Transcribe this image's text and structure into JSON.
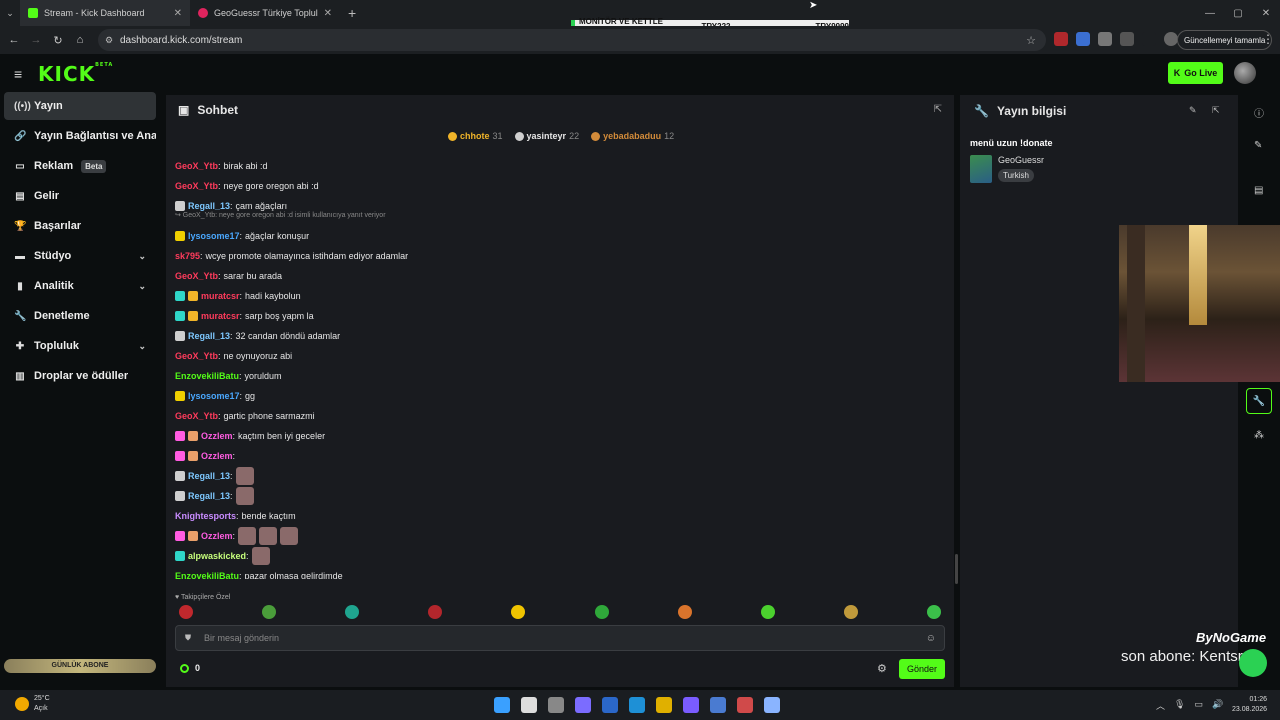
{
  "browser": {
    "tabs": [
      {
        "title": "Stream - Kick Dashboard",
        "favicon_color": "#53fc18",
        "active": true
      },
      {
        "title": "GeoGuessr Türkiye Topluluk Tu",
        "favicon_color": "#e0245e",
        "active": false
      }
    ],
    "new_tab": "+",
    "url": "dashboard.kick.com/stream",
    "update_button": "Güncellemeyi tamamla",
    "window_controls": {
      "minimize": "—",
      "maximize": "▢",
      "close": "✕"
    }
  },
  "ticker": {
    "label": "MONİTÖR VE KETTLE🔥",
    "price1": "TRY222",
    "price2": "TRY9999"
  },
  "kick": {
    "logo": "KICK",
    "logo_sup": "BETA",
    "go_live": "Go Live"
  },
  "sidebar": {
    "items": [
      {
        "label": "Yayın",
        "icon": "broadcast-icon",
        "glyph": "((•))",
        "active": true
      },
      {
        "label": "Yayın Bağlantısı ve Anahtarı",
        "icon": "link-icon",
        "glyph": "🔗"
      },
      {
        "label": "Reklam",
        "icon": "ad-icon",
        "glyph": "▭",
        "badge": "Beta"
      },
      {
        "label": "Gelir",
        "icon": "revenue-icon",
        "glyph": "▤"
      },
      {
        "label": "Başarılar",
        "icon": "trophy-icon",
        "glyph": "🏆"
      },
      {
        "label": "Stüdyo",
        "icon": "studio-icon",
        "glyph": "▬",
        "chevron": true
      },
      {
        "label": "Analitik",
        "icon": "analytics-icon",
        "glyph": "▮",
        "chevron": true
      },
      {
        "label": "Denetleme",
        "icon": "wrench-icon",
        "glyph": "🔧"
      },
      {
        "label": "Topluluk",
        "icon": "community-icon",
        "glyph": "✚",
        "chevron": true
      },
      {
        "label": "Droplar ve ödüller",
        "icon": "drops-icon",
        "glyph": "▥"
      }
    ],
    "sub_goal": "GÜNLÜK ABONE"
  },
  "chat": {
    "title": "Sohbet",
    "leaders": [
      {
        "name": "chhote",
        "count": "31",
        "color": "#f0b429",
        "badge": "#f0b429"
      },
      {
        "name": "yasinteyr",
        "count": "22",
        "color": "#e6e6e6",
        "badge": "#cfcfcf"
      },
      {
        "name": "yebadabaduu",
        "count": "12",
        "color": "#d28b3a",
        "badge": "#d28b3a"
      }
    ],
    "reply_note": "↪ GeoX_Ytb: neye gore oregon abi :d isimli kullanıcıya yanıt veriyor",
    "messages": [
      {
        "user": "GeoX_Ytb",
        "color": "#ff3b5c",
        "text": "birak abi :d",
        "badges": []
      },
      {
        "user": "GeoX_Ytb",
        "color": "#ff3b5c",
        "text": "neye gore oregon abi :d",
        "badges": []
      },
      {
        "user": "Regall_13",
        "color": "#7ec8ff",
        "text": "çam ağaçları",
        "badges": [
          "#cfcfcf"
        ]
      },
      {
        "user": "lysosome17",
        "color": "#4aa8ff",
        "text": "ağaçlar konuşur",
        "badges": [
          "#f0d000"
        ]
      },
      {
        "user": "sk795",
        "color": "#ff3b5c",
        "text": "wcye promote olamayınca istihdam ediyor adamlar",
        "badges": []
      },
      {
        "user": "GeoX_Ytb",
        "color": "#ff3b5c",
        "text": "sarar bu arada",
        "badges": []
      },
      {
        "user": "muratcsr",
        "color": "#ff3b5c",
        "text": "hadi kaybolun",
        "badges": [
          "#2fd6c8",
          "#f0b429"
        ]
      },
      {
        "user": "muratcsr",
        "color": "#ff3b5c",
        "text": "sarp boş yapm la",
        "badges": [
          "#2fd6c8",
          "#f0b429"
        ]
      },
      {
        "user": "Regall_13",
        "color": "#7ec8ff",
        "text": "32 candan döndü adamlar",
        "badges": [
          "#cfcfcf"
        ]
      },
      {
        "user": "GeoX_Ytb",
        "color": "#ff3b5c",
        "text": "ne oynuyoruz abi",
        "badges": []
      },
      {
        "user": "EnzovekiliBatu",
        "color": "#53fc18",
        "text": "yoruldum",
        "badges": []
      },
      {
        "user": "lysosome17",
        "color": "#4aa8ff",
        "text": "gg",
        "badges": [
          "#f0d000"
        ]
      },
      {
        "user": "GeoX_Ytb",
        "color": "#ff3b5c",
        "text": "gartic phone sarmazmi",
        "badges": []
      },
      {
        "user": "Ozzlem",
        "color": "#ff5ce1",
        "text": "kaçtım ben iyi geceler",
        "badges": [
          "#ff5ce1",
          "#e9a06a"
        ]
      },
      {
        "user": "Ozzlem",
        "color": "#ff5ce1",
        "text": "",
        "badges": [
          "#ff5ce1",
          "#e9a06a"
        ],
        "emotes": 0
      },
      {
        "user": "Regall_13",
        "color": "#7ec8ff",
        "text": "",
        "badges": [
          "#cfcfcf"
        ],
        "emotes": 1
      },
      {
        "user": "Regall_13",
        "color": "#7ec8ff",
        "text": "",
        "badges": [
          "#cfcfcf"
        ],
        "emotes": 1
      },
      {
        "user": "Knightesports",
        "color": "#c98cff",
        "text": "bende kaçtım",
        "badges": []
      },
      {
        "user": "Ozzlem",
        "color": "#ff5ce1",
        "text": "",
        "badges": [
          "#ff5ce1",
          "#e9a06a"
        ],
        "emotes": 3
      },
      {
        "user": "alpwaskicked",
        "color": "#c7ff7c",
        "text": "",
        "badges": [
          "#2fd6c8"
        ],
        "emotes": 1
      },
      {
        "user": "EnzovekiliBatu",
        "color": "#53fc18",
        "text": "pazar olmasa gelirdimde",
        "badges": []
      }
    ],
    "favorites_label": "♥ Takipçilere Özel",
    "emote_colors": [
      "#c0282d",
      "#4a9d3a",
      "#1fa58f",
      "#b3262c",
      "#f0c400",
      "#2fa83a",
      "#d9742c",
      "#4bd12e",
      "#c09a3b",
      "#3bbf4a"
    ],
    "input_placeholder": "Bir mesaj gönderin",
    "points": "0",
    "send_label": "Gönder"
  },
  "info": {
    "title": "Yayın bilgisi",
    "stream_title": "menü uzun !donate",
    "category": "GeoGuessr",
    "tag": "Turkish"
  },
  "overlay": {
    "brand": "ByNoGame",
    "text": "son abone: Kentsrrr"
  },
  "taskbar": {
    "temp": "25°C",
    "weather": "Açık",
    "time": "01:26",
    "date": "23.08.2026",
    "icon_colors": [
      "#3aa0ff",
      "#dddddd",
      "#888888",
      "#7b6cff",
      "#2b67c9",
      "#1e90d6",
      "#e0b000",
      "#7a5cff",
      "#4a7bd1",
      "#d04a4a",
      "#8ab4ff"
    ]
  }
}
